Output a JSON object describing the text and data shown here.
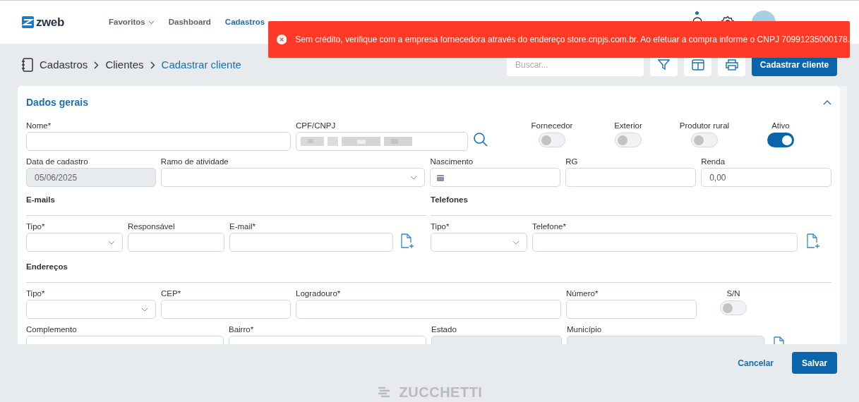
{
  "header": {
    "logo": "zweb",
    "nav": [
      {
        "label": "Favoritos",
        "selected": false,
        "caret": true
      },
      {
        "label": "Dashboard",
        "selected": false,
        "caret": false
      },
      {
        "label": "Cadastros",
        "selected": true,
        "caret": false
      }
    ],
    "notification": true
  },
  "toast": {
    "kind": "error",
    "message": "Sem crédito, verifique com a empresa fornecedora através do endereço store.cnpjs.com.br. Ao efetuar a compra informe o CNPJ 70991235000178."
  },
  "breadcrumb": [
    {
      "label": "Cadastros",
      "current": false
    },
    {
      "label": "Clientes",
      "current": false
    },
    {
      "label": "Cadastrar cliente",
      "current": true
    }
  ],
  "search": {
    "placeholder": "Buscar..."
  },
  "primary_button": "Cadastrar cliente",
  "general": {
    "title": "Dados gerais",
    "expanded": true,
    "rows": [
      [
        {
          "kind": "text",
          "label": "Nome*"
        },
        {
          "kind": "masked",
          "label": "CPF/CNPJ"
        },
        {
          "kind": "search"
        }
      ],
      [
        {
          "kind": "text",
          "label": "Data de cadastro",
          "value": "05/06/2025",
          "disabled": true
        },
        {
          "kind": "select",
          "label": "Ramo de atividade"
        },
        {
          "kind": "date",
          "label": "Nascimento"
        },
        {
          "kind": "text",
          "label": "RG"
        },
        {
          "kind": "text",
          "label": "Renda",
          "value": "0,00"
        }
      ]
    ],
    "toggles": [
      {
        "kind": "toggle",
        "label": "Fornecedor",
        "on": false
      },
      {
        "kind": "toggle",
        "label": "Exterior",
        "on": false
      },
      {
        "kind": "toggle",
        "label": "Produtor rural",
        "on": false
      },
      {
        "kind": "toggle",
        "label": "Ativo",
        "on": true
      }
    ]
  },
  "emails": {
    "title": "E-mails",
    "fields": [
      {
        "kind": "select",
        "label": "Tipo*"
      },
      {
        "kind": "text",
        "label": "Responsável"
      },
      {
        "kind": "text",
        "label": "E-mail*"
      },
      {
        "kind": "add"
      }
    ]
  },
  "phones": {
    "title": "Telefones",
    "fields": [
      {
        "kind": "select",
        "label": "Tipo*"
      },
      {
        "kind": "text",
        "label": "Telefone*"
      },
      {
        "kind": "add"
      }
    ]
  },
  "addresses": {
    "title": "Endereços",
    "rows": [
      [
        {
          "kind": "select",
          "label": "Tipo*"
        },
        {
          "kind": "text",
          "label": "CEP*"
        },
        {
          "kind": "text",
          "label": "Logradouro*"
        },
        {
          "kind": "text",
          "label": "Número*"
        },
        {
          "kind": "toggle",
          "label": "S/N",
          "on": false
        }
      ],
      [
        {
          "kind": "text",
          "label": "Complemento"
        },
        {
          "kind": "text",
          "label": "Bairro*"
        },
        {
          "kind": "text",
          "label": "Estado",
          "disabled": true
        },
        {
          "kind": "text",
          "label": "Município",
          "disabled": true
        },
        {
          "kind": "add"
        }
      ]
    ]
  },
  "footer": {
    "buttons": [
      {
        "label": "Cancelar",
        "kind": "link"
      },
      {
        "label": "Salvar",
        "kind": "primary"
      }
    ],
    "brand": "ZUCCHETTI"
  }
}
